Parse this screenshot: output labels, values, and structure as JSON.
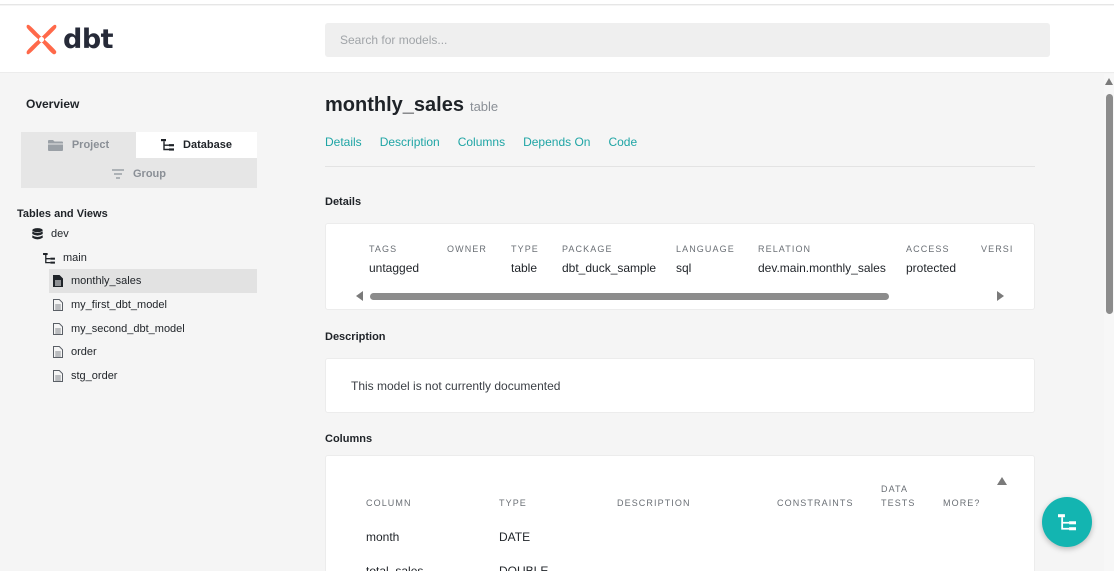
{
  "header": {
    "logo_text": "dbt",
    "search_placeholder": "Search for models..."
  },
  "sidebar": {
    "overview_label": "Overview",
    "tabs": {
      "project": "Project",
      "database": "Database",
      "group": "Group"
    },
    "section_label": "Tables and Views",
    "tree": {
      "database": "dev",
      "schema": "main",
      "models": [
        "monthly_sales",
        "my_first_dbt_model",
        "my_second_dbt_model",
        "order",
        "stg_order"
      ],
      "active_model": "monthly_sales"
    }
  },
  "main": {
    "title": "monthly_sales",
    "subtitle": "table",
    "tabs": [
      "Details",
      "Description",
      "Columns",
      "Depends On",
      "Code"
    ],
    "details": {
      "section_title": "Details",
      "fields": [
        {
          "label": "TAGS",
          "value": "untagged"
        },
        {
          "label": "OWNER",
          "value": ""
        },
        {
          "label": "TYPE",
          "value": "table"
        },
        {
          "label": "PACKAGE",
          "value": "dbt_duck_sample"
        },
        {
          "label": "LANGUAGE",
          "value": "sql"
        },
        {
          "label": "RELATION",
          "value": "dev.main.monthly_sales"
        },
        {
          "label": "ACCESS",
          "value": "protected"
        },
        {
          "label": "VERSI",
          "value": ""
        }
      ]
    },
    "description": {
      "section_title": "Description",
      "text": "This model is not currently documented"
    },
    "columns": {
      "section_title": "Columns",
      "headers": [
        "COLUMN",
        "TYPE",
        "DESCRIPTION",
        "CONSTRAINTS",
        "DATA TESTS",
        "MORE?"
      ],
      "rows": [
        {
          "column": "month",
          "type": "DATE"
        },
        {
          "column": "total_sales",
          "type": "DOUBLE"
        }
      ]
    }
  },
  "colors": {
    "accent": "#1fa5a5",
    "logo": "#ff694a",
    "fab": "#13b5b1"
  }
}
